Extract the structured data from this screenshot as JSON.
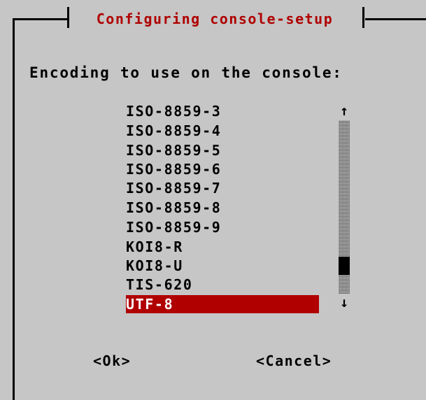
{
  "dialog": {
    "title": "Configuring console-setup",
    "prompt": "Encoding to use on the console:"
  },
  "encoding_list": {
    "items": [
      "ISO-8859-3",
      "ISO-8859-4",
      "ISO-8859-5",
      "ISO-8859-6",
      "ISO-8859-7",
      "ISO-8859-8",
      "ISO-8859-9",
      "KOI8-R",
      "KOI8-U",
      "TIS-620",
      "UTF-8"
    ],
    "selected": "UTF-8"
  },
  "scrollbar": {
    "up_arrow": "↑",
    "down_arrow": "↓"
  },
  "buttons": {
    "ok": "<Ok>",
    "cancel": "<Cancel>"
  },
  "colors": {
    "background": "#c6c6c6",
    "title": "#b00000",
    "selection": "#b00000",
    "selection_text": "#ffffff"
  }
}
